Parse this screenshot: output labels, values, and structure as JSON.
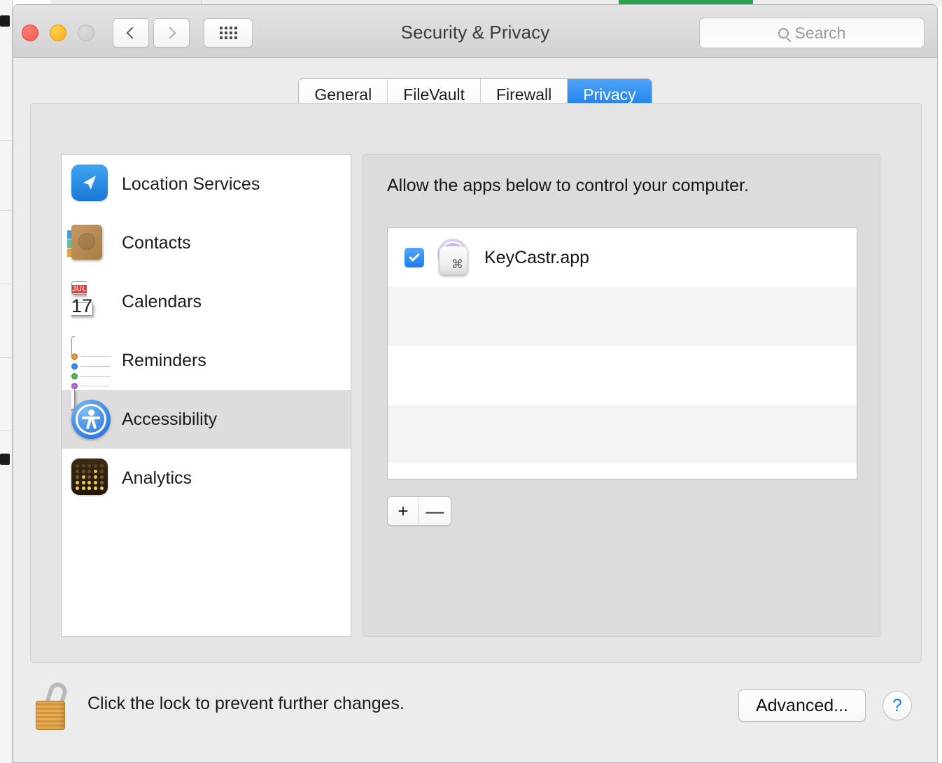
{
  "window": {
    "title": "Security & Privacy",
    "traffic_lights": [
      "close",
      "minimize",
      "zoom"
    ],
    "back_icon": "chevron-left-icon",
    "forward_icon": "chevron-right-icon",
    "grid_icon": "show-all-grid-icon"
  },
  "search": {
    "placeholder": "Search",
    "value": "",
    "icon": "search-icon"
  },
  "tabs": [
    {
      "label": "General",
      "active": false
    },
    {
      "label": "FileVault",
      "active": false
    },
    {
      "label": "Firewall",
      "active": false
    },
    {
      "label": "Privacy",
      "active": true
    }
  ],
  "sidebar": {
    "items": [
      {
        "label": "Location Services",
        "icon": "location-services-icon",
        "selected": false
      },
      {
        "label": "Contacts",
        "icon": "contacts-icon",
        "selected": false
      },
      {
        "label": "Calendars",
        "icon": "calendars-icon",
        "selected": false
      },
      {
        "label": "Reminders",
        "icon": "reminders-icon",
        "selected": false
      },
      {
        "label": "Accessibility",
        "icon": "accessibility-icon",
        "selected": true
      },
      {
        "label": "Analytics",
        "icon": "analytics-icon",
        "selected": false
      }
    ],
    "calendar_icon": {
      "month": "JUL",
      "day": "17"
    }
  },
  "panel": {
    "description": "Allow the apps below to control your computer.",
    "apps": [
      {
        "name": "KeyCastr.app",
        "checked": true,
        "icon": "keycastr-icon",
        "key_glyph": "⌘"
      }
    ],
    "empty_rows": 4,
    "add_label": "+",
    "remove_label": "—"
  },
  "footer": {
    "lock_icon": "unlocked-padlock-icon",
    "lock_text": "Click the lock to prevent further changes.",
    "advanced_label": "Advanced...",
    "help_label": "?"
  },
  "colors": {
    "accent_blue": "#1a7ced",
    "tab_active_blue": "#2d8ef2",
    "selected_row_gray": "#dddddd",
    "window_bg": "#ececec",
    "panel_bg": "#dcdcdc",
    "help_blue": "#1a7ced",
    "lock_gold": "#e8ab52",
    "keycastr_purple": "#c3a4e0"
  }
}
